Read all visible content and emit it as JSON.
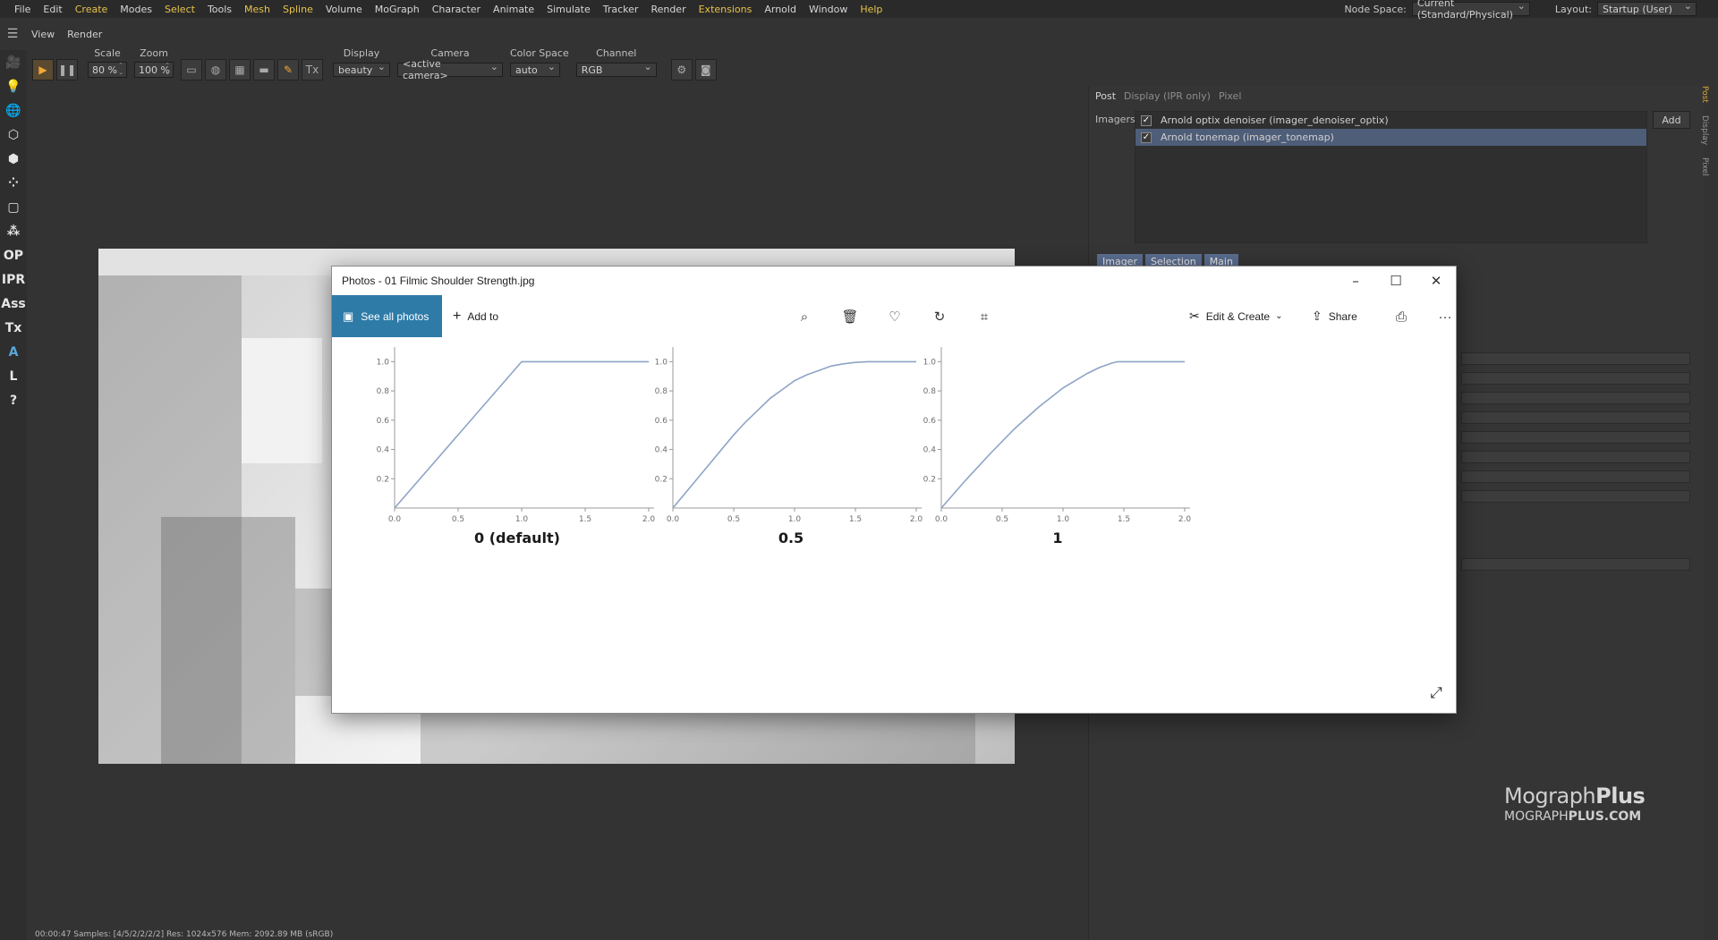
{
  "menubar": {
    "items": [
      {
        "label": "File",
        "yellow": false
      },
      {
        "label": "Edit",
        "yellow": false
      },
      {
        "label": "Create",
        "yellow": true
      },
      {
        "label": "Modes",
        "yellow": false
      },
      {
        "label": "Select",
        "yellow": true
      },
      {
        "label": "Tools",
        "yellow": false
      },
      {
        "label": "Mesh",
        "yellow": true
      },
      {
        "label": "Spline",
        "yellow": true
      },
      {
        "label": "Volume",
        "yellow": false
      },
      {
        "label": "MoGraph",
        "yellow": false
      },
      {
        "label": "Character",
        "yellow": false
      },
      {
        "label": "Animate",
        "yellow": false
      },
      {
        "label": "Simulate",
        "yellow": false
      },
      {
        "label": "Tracker",
        "yellow": false
      },
      {
        "label": "Render",
        "yellow": false
      },
      {
        "label": "Extensions",
        "yellow": true
      },
      {
        "label": "Arnold",
        "yellow": false
      },
      {
        "label": "Window",
        "yellow": false
      },
      {
        "label": "Help",
        "yellow": true
      }
    ],
    "node_space_label": "Node Space:",
    "node_space_value": "Current (Standard/Physical)",
    "layout_label": "Layout:",
    "layout_value": "Startup (User)"
  },
  "viewbar": {
    "view": "View",
    "render": "Render"
  },
  "lefttools": [
    "🎥",
    "💡",
    "🌐",
    "⬡",
    "⬢",
    "⁘",
    "▢",
    "⁂",
    "OP",
    "IPR",
    "Ass",
    "Tx",
    "A",
    "L",
    "?"
  ],
  "ipr": {
    "scale_label": "Scale",
    "scale_value": "80 %",
    "zoom_label": "Zoom",
    "zoom_value": "100 %",
    "display_label": "Display",
    "display_value": "beauty",
    "camera_label": "Camera",
    "camera_value": "<active camera>",
    "colorspace_label": "Color Space",
    "colorspace_value": "auto",
    "channel_label": "Channel",
    "channel_value": "RGB"
  },
  "status": "00:00:47  Samples: [4/5/2/2/2/2]  Res: 1024x576  Mem: 2092.89 MB  (sRGB)",
  "rightpanel": {
    "tabs": [
      {
        "label": "Post",
        "active": true
      },
      {
        "label": "Display (IPR only)",
        "active": false
      },
      {
        "label": "Pixel",
        "active": false
      }
    ],
    "imagers_label": "Imagers",
    "imagers": [
      {
        "label": "Arnold optix denoiser (imager_denoiser_optix)",
        "checked": true,
        "selected": false
      },
      {
        "label": "Arnold tonemap (imager_tonemap)",
        "checked": true,
        "selected": true
      }
    ],
    "add_label": "Add",
    "subtabs": [
      "Imager",
      "Selection",
      "Main"
    ],
    "vtabs": [
      "Post",
      "Display",
      "Pixel"
    ]
  },
  "logo": {
    "line1_a": "Mograph",
    "line1_b": "Plus",
    "line2_a": "MOGRAPH",
    "line2_b": "PLUS.COM"
  },
  "photos": {
    "title": "Photos - 01 Filmic Shoulder Strength.jpg",
    "see_all": "See all photos",
    "add_to": "Add to",
    "edit_create": "Edit & Create",
    "share": "Share",
    "more": "···"
  },
  "chart_data": [
    {
      "type": "line",
      "caption": "0 (default)",
      "x": [
        0.0,
        1.0,
        2.0
      ],
      "y": [
        0.0,
        1.0,
        1.0
      ],
      "xticks": [
        "0.0",
        "0.5",
        "1.0",
        "1.5",
        "2.0"
      ],
      "yticks": [
        "0.2",
        "0.4",
        "0.6",
        "0.8",
        "1.0"
      ],
      "xlim": [
        0,
        2
      ],
      "ylim": [
        0,
        1.1
      ],
      "color": "#8ea4c6"
    },
    {
      "type": "line",
      "caption": "0.5",
      "x": [
        0.0,
        0.25,
        0.5,
        0.6,
        0.7,
        0.8,
        0.9,
        1.0,
        1.1,
        1.2,
        1.3,
        1.4,
        1.5,
        1.6,
        1.7,
        1.8,
        2.0
      ],
      "y": [
        0.0,
        0.25,
        0.5,
        0.59,
        0.67,
        0.75,
        0.81,
        0.87,
        0.91,
        0.94,
        0.97,
        0.985,
        0.995,
        1.0,
        1.0,
        1.0,
        1.0
      ],
      "xticks": [
        "0.0",
        "0.5",
        "1.0",
        "1.5",
        "2.0"
      ],
      "yticks": [
        "0.2",
        "0.4",
        "0.6",
        "0.8",
        "1.0"
      ],
      "xlim": [
        0,
        2
      ],
      "ylim": [
        0,
        1.1
      ],
      "color": "#8ea4c6"
    },
    {
      "type": "line",
      "caption": "1",
      "x": [
        0.0,
        0.2,
        0.4,
        0.6,
        0.8,
        1.0,
        1.2,
        1.3,
        1.4,
        1.45,
        2.0
      ],
      "y": [
        0.0,
        0.19,
        0.37,
        0.54,
        0.69,
        0.82,
        0.92,
        0.96,
        0.99,
        1.0,
        1.0
      ],
      "xticks": [
        "0.0",
        "0.5",
        "1.0",
        "1.5",
        "2.0"
      ],
      "yticks": [
        "0.2",
        "0.4",
        "0.6",
        "0.8",
        "1.0"
      ],
      "xlim": [
        0,
        2
      ],
      "ylim": [
        0,
        1.1
      ],
      "color": "#8ea4c6"
    }
  ]
}
